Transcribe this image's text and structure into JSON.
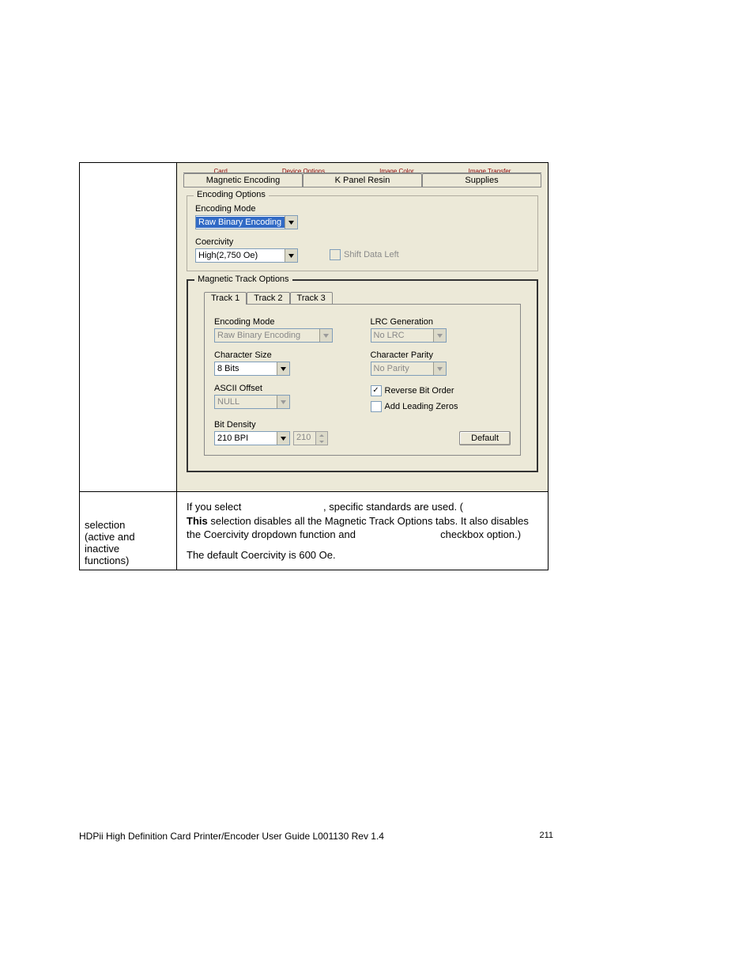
{
  "topCutRow": [
    "Card",
    "Device Options",
    "Image Color",
    "Image Transfer"
  ],
  "tabs": {
    "magnetic": "Magnetic Encoding",
    "kpanel": "K Panel Resin",
    "supplies": "Supplies"
  },
  "encodingOptions": {
    "title": "Encoding Options",
    "encodingModeLabel": "Encoding Mode",
    "encodingModeValue": "Raw Binary Encoding",
    "coercivityLabel": "Coercivity",
    "coercivityValue": "High(2,750 Oe)",
    "shiftDataLeft": "Shift Data Left"
  },
  "trackOptions": {
    "title": "Magnetic Track Options",
    "tabs": [
      "Track 1",
      "Track 2",
      "Track 3"
    ],
    "encodingModeLabel": "Encoding Mode",
    "encodingModeValue": "Raw Binary Encoding",
    "charSizeLabel": "Character Size",
    "charSizeValue": "8 Bits",
    "asciiOffsetLabel": "ASCII Offset",
    "asciiOffsetValue": "NULL",
    "bitDensityLabel": "Bit Density",
    "bitDensityValue": "210 BPI",
    "bitDensitySpin": "210",
    "lrcLabel": "LRC Generation",
    "lrcValue": "No LRC",
    "charParityLabel": "Character Parity",
    "charParityValue": "No Parity",
    "reverseBitOrder": "Reverse Bit Order",
    "addLeadingZeros": "Add Leading Zeros",
    "defaultBtn": "Default"
  },
  "leftCell": {
    "l1": "selection",
    "l2": "(active and",
    "l3": "inactive",
    "l4": "functions)"
  },
  "explain": {
    "t1a": "If you select ",
    "t1b": ", specific standards are used. (",
    "note": "This",
    "t2": "selection disables all the Magnetic Track Options tabs. It also disables the",
    "t3a": "Coercivity dropdown function and ",
    "t3b": " checkbox option.)",
    "t4": "The default Coercivity is 600 Oe."
  },
  "footer": {
    "left": "HDPii High Definition Card Printer/Encoder User Guide    L001130 Rev 1.4",
    "page": "211"
  }
}
